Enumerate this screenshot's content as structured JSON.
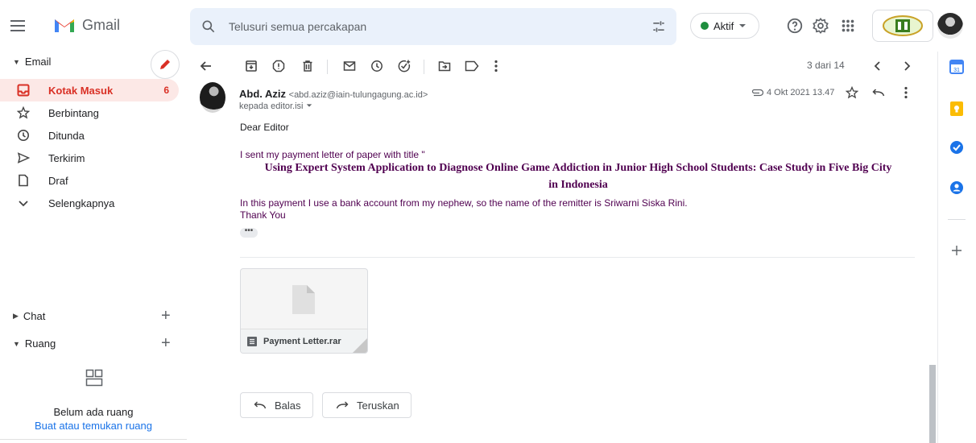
{
  "app": {
    "name": "Gmail"
  },
  "search": {
    "placeholder": "Telusuri semua percakapan"
  },
  "status": {
    "label": "Aktif"
  },
  "sidebar": {
    "email_header": "Email",
    "items": [
      {
        "label": "Kotak Masuk",
        "count": "6",
        "icon": "inbox-icon"
      },
      {
        "label": "Berbintang",
        "icon": "star-icon"
      },
      {
        "label": "Ditunda",
        "icon": "clock-icon"
      },
      {
        "label": "Terkirim",
        "icon": "send-icon"
      },
      {
        "label": "Draf",
        "icon": "draft-icon"
      },
      {
        "label": "Selengkapnya",
        "icon": "chevron-down-icon"
      }
    ],
    "chat_header": "Chat",
    "rooms_header": "Ruang",
    "rooms_empty": "Belum ada ruang",
    "rooms_link": "Buat atau temukan ruang"
  },
  "toolbar": {
    "pager": "3 dari 14"
  },
  "message": {
    "sender_name": "Abd. Aziz",
    "sender_email": "<abd.aziz@iain-tulungagung.ac.id>",
    "to_line": "kepada editor.isi",
    "date": "4 Okt 2021 13.47",
    "greeting": "Dear Editor",
    "line1": "I sent my payment letter of paper with title \"",
    "title_line1": "Using Expert System Application to Diagnose Online Game Addiction in Junior High School Students: Case Study in Five Big City",
    "title_line2": "in Indonesia",
    "line2": "In this payment I use a bank account from my nephew, so the name of the remitter is Sriwarni Siska Rini.",
    "line3": "Thank You",
    "ellipsis": "•••",
    "attachment_name": "Payment Letter.rar"
  },
  "actions": {
    "reply": "Balas",
    "forward": "Teruskan"
  },
  "colors": {
    "accent_red": "#d93025",
    "active_bg": "#fce8e6",
    "quote_purple": "#500050",
    "status_green": "#1e8e3e",
    "link_blue": "#1a73e8"
  }
}
